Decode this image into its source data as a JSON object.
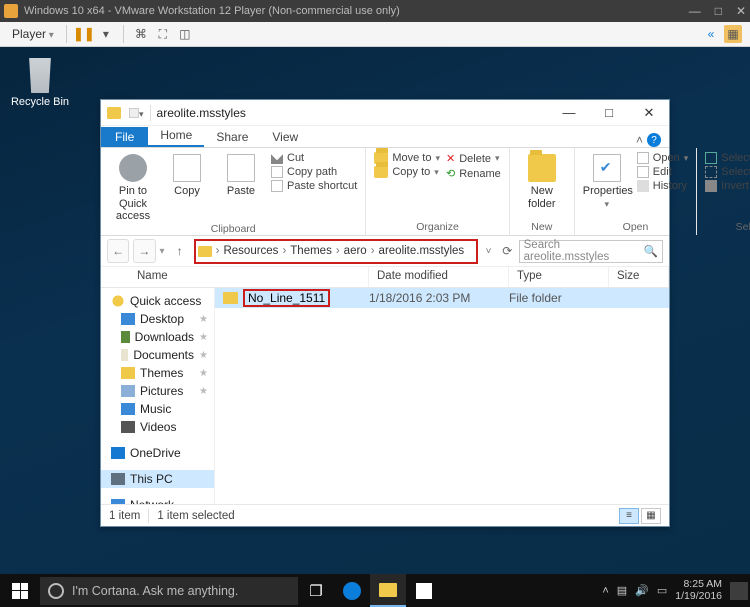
{
  "vmware": {
    "title": "Windows 10 x64 - VMware Workstation 12 Player (Non-commercial use only)",
    "player_label": "Player"
  },
  "desktop": {
    "recycle_bin": "Recycle Bin"
  },
  "explorer": {
    "title": "areolite.msstyles",
    "tabs": {
      "file": "File",
      "home": "Home",
      "share": "Share",
      "view": "View"
    },
    "ribbon": {
      "clipboard": {
        "label": "Clipboard",
        "pinto": "Pin to Quick access",
        "copy": "Copy",
        "paste": "Paste",
        "cut": "Cut",
        "copypath": "Copy path",
        "pasteshortcut": "Paste shortcut"
      },
      "organize": {
        "label": "Organize",
        "moveto": "Move to",
        "copyto": "Copy to",
        "delete": "Delete",
        "rename": "Rename"
      },
      "new": {
        "label": "New",
        "newfolder": "New folder"
      },
      "open": {
        "label": "Open",
        "properties": "Properties",
        "open": "Open",
        "edit": "Edit",
        "history": "History"
      },
      "select": {
        "label": "Select",
        "selectall": "Select all",
        "selectnone": "Select none",
        "invert": "Invert selection"
      }
    },
    "breadcrumb": [
      "Resources",
      "Themes",
      "aero",
      "areolite.msstyles"
    ],
    "search_placeholder": "Search areolite.msstyles",
    "columns": {
      "name": "Name",
      "date": "Date modified",
      "type": "Type",
      "size": "Size"
    },
    "nav": {
      "quickaccess": "Quick access",
      "desktop": "Desktop",
      "downloads": "Downloads",
      "documents": "Documents",
      "themes": "Themes",
      "pictures": "Pictures",
      "music": "Music",
      "videos": "Videos",
      "onedrive": "OneDrive",
      "thispc": "This PC",
      "network": "Network"
    },
    "rows": [
      {
        "name": "No_Line_1511",
        "date": "1/18/2016 2:03 PM",
        "type": "File folder",
        "size": ""
      }
    ],
    "status": {
      "count": "1 item",
      "selected": "1 item selected"
    }
  },
  "taskbar": {
    "cortana": "I'm Cortana. Ask me anything.",
    "time": "8:25 AM",
    "date": "1/19/2016"
  }
}
